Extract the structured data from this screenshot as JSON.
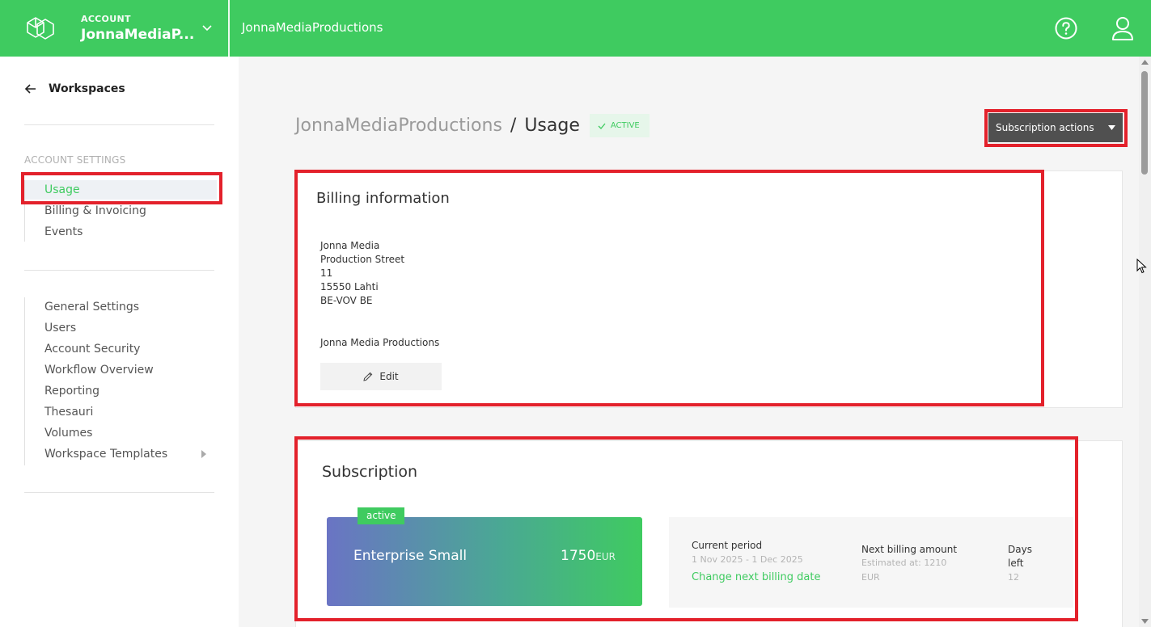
{
  "topbar": {
    "account_label": "ACCOUNT",
    "account_name": "JonnaMediaP...",
    "workspace_title": "JonnaMediaProductions",
    "accent_color": "#3fcb60"
  },
  "sidebar": {
    "back_label": "Workspaces",
    "section_label": "ACCOUNT SETTINGS",
    "account_items": [
      "Usage",
      "Billing & Invoicing",
      "Events"
    ],
    "active_item": "Usage",
    "workspace_items": [
      "General Settings",
      "Users",
      "Account Security",
      "Workflow Overview",
      "Reporting",
      "Thesauri",
      "Volumes",
      "Workspace Templates"
    ]
  },
  "header": {
    "breadcrumb_parent": "JonnaMediaProductions",
    "breadcrumb_separator": "/",
    "breadcrumb_current": "Usage",
    "status": "ACTIVE",
    "actions_button": "Subscription actions"
  },
  "billing": {
    "title": "Billing information",
    "address_lines": [
      "Jonna Media",
      "Production Street",
      "11",
      "15550 Lahti",
      "BE-VOV BE"
    ],
    "company": "Jonna Media Productions",
    "edit_label": "Edit"
  },
  "subscription": {
    "title": "Subscription",
    "tag": "active",
    "plan_name": "Enterprise Small",
    "price": "1750",
    "currency": "EUR",
    "current_period_label": "Current period",
    "current_period_value": "1 Nov 2025 - 1 Dec 2025",
    "change_date_link": "Change next billing date",
    "next_amount_label": "Next billing amount",
    "next_amount_estimate": "Estimated at: 1210",
    "next_amount_currency": "EUR",
    "days_left_label_1": "Days",
    "days_left_label_2": "left",
    "days_left_value": "12"
  }
}
